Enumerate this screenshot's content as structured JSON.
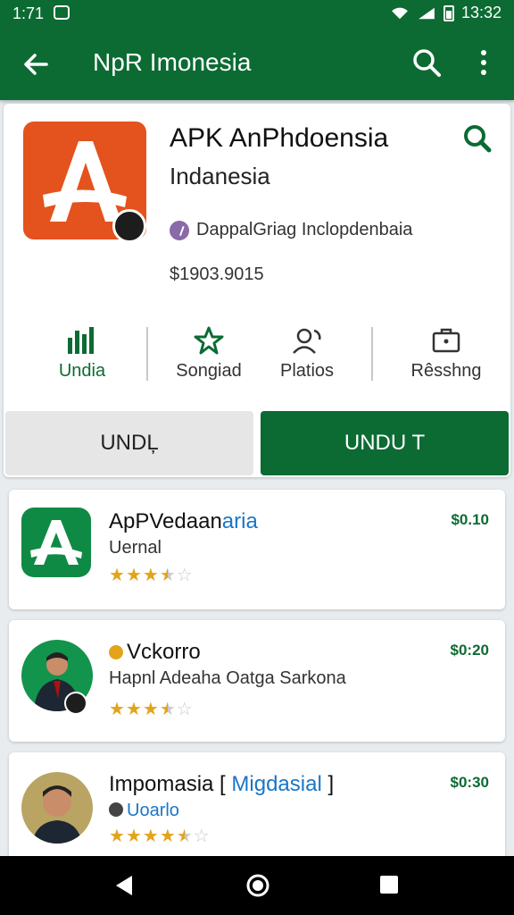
{
  "status_bar": {
    "time_left": "1:71",
    "time_right": "13:32"
  },
  "app_bar": {
    "title": "NpR Imonesia",
    "icons": [
      "back-arrow-icon",
      "search-icon",
      "more-vert-icon"
    ]
  },
  "main_app": {
    "title": "APK AnPhdoensia",
    "subtitle": "Indanesia",
    "developer": "DappalGriag Inclopdenbaia",
    "price": "$1903.9015",
    "logo_letter": "A",
    "brand_color": "#e4521d",
    "stats": [
      {
        "label": "Undia",
        "icon": "chart-icon"
      },
      {
        "label": "Songiad",
        "icon": "star-outline-icon"
      },
      {
        "label": "Platios",
        "icon": "person-refresh-icon"
      },
      {
        "label": "Rêsshng",
        "icon": "briefcase-icon"
      }
    ],
    "secondary_button": "UNDĻ",
    "primary_button": "UNDU T"
  },
  "list": [
    {
      "title": "ApPVedaan",
      "title_accent": "aria",
      "subtitle": "Uernal",
      "price": "$0.10",
      "rating": 3.5
    },
    {
      "title": "Vckorro",
      "subtitle": "Hapnl Adeaha Oatga Sarkona",
      "price": "$0:20",
      "rating": 3.5
    },
    {
      "title": "Impomasia [ ",
      "title_accent": "Migdasial",
      "title_end": " ]",
      "subtitle": "Uoarlo",
      "price": "$0:30",
      "rating": 4.5
    }
  ],
  "theme": {
    "primary": "#0c6b33",
    "accent_blue": "#1976c8",
    "star": "#e2a41a"
  }
}
